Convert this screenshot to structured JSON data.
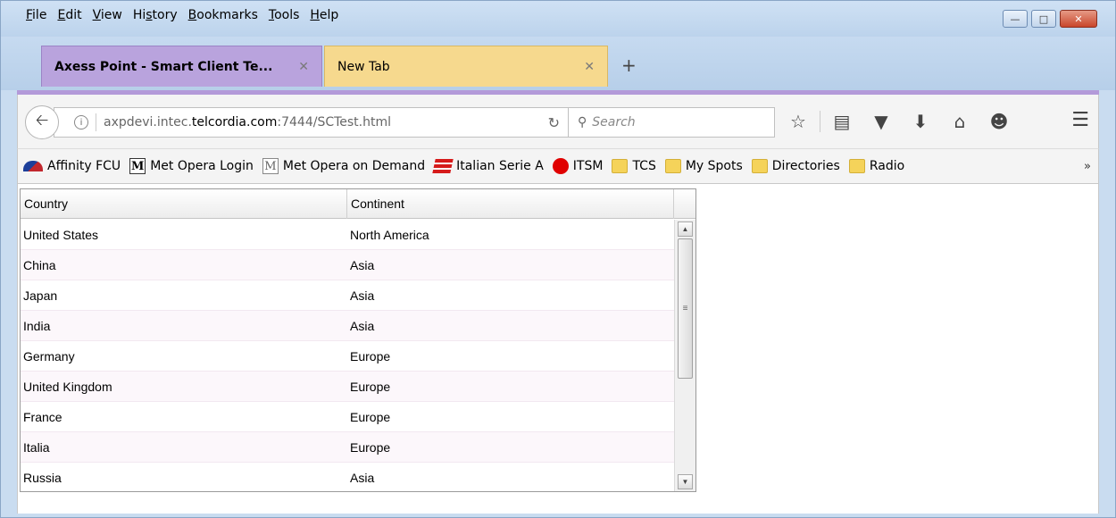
{
  "menu": [
    "File",
    "Edit",
    "View",
    "History",
    "Bookmarks",
    "Tools",
    "Help"
  ],
  "menu_underline": [
    "F",
    "E",
    "V",
    "s",
    "B",
    "T",
    "H"
  ],
  "tabs": [
    {
      "label": "Axess Point - Smart Client Te...",
      "active": true
    },
    {
      "label": "New Tab",
      "active": false
    }
  ],
  "url": {
    "prefix": "axpdevi.intec.",
    "domain": "telcordia.com",
    "suffix": ":7444/SCTest.html"
  },
  "search": {
    "placeholder": "Search"
  },
  "bookmarks": [
    {
      "label": "Affinity FCU",
      "icon": "affinity-logo-icon"
    },
    {
      "label": "Met Opera Login",
      "icon": "m-logo-icon"
    },
    {
      "label": "Met Opera on Demand",
      "icon": "m-logo-icon"
    },
    {
      "label": "Italian Serie A",
      "icon": "serie-a-icon"
    },
    {
      "label": "ITSM",
      "icon": "red-circle-icon"
    },
    {
      "label": "TCS",
      "icon": "folder-icon"
    },
    {
      "label": "My Spots",
      "icon": "folder-icon"
    },
    {
      "label": "Directories",
      "icon": "folder-icon"
    },
    {
      "label": "Radio",
      "icon": "folder-icon"
    }
  ],
  "grid": {
    "headers": [
      "Country",
      "Continent"
    ],
    "rows": [
      [
        "United States",
        "North America"
      ],
      [
        "China",
        "Asia"
      ],
      [
        "Japan",
        "Asia"
      ],
      [
        "India",
        "Asia"
      ],
      [
        "Germany",
        "Europe"
      ],
      [
        "United Kingdom",
        "Europe"
      ],
      [
        "France",
        "Europe"
      ],
      [
        "Italia",
        "Europe"
      ],
      [
        "Russia",
        "Asia"
      ]
    ]
  },
  "colors": {
    "active_tab": "#b9a3dd",
    "new_tab": "#f6d98e",
    "window_frame": "#c9dcf0"
  }
}
